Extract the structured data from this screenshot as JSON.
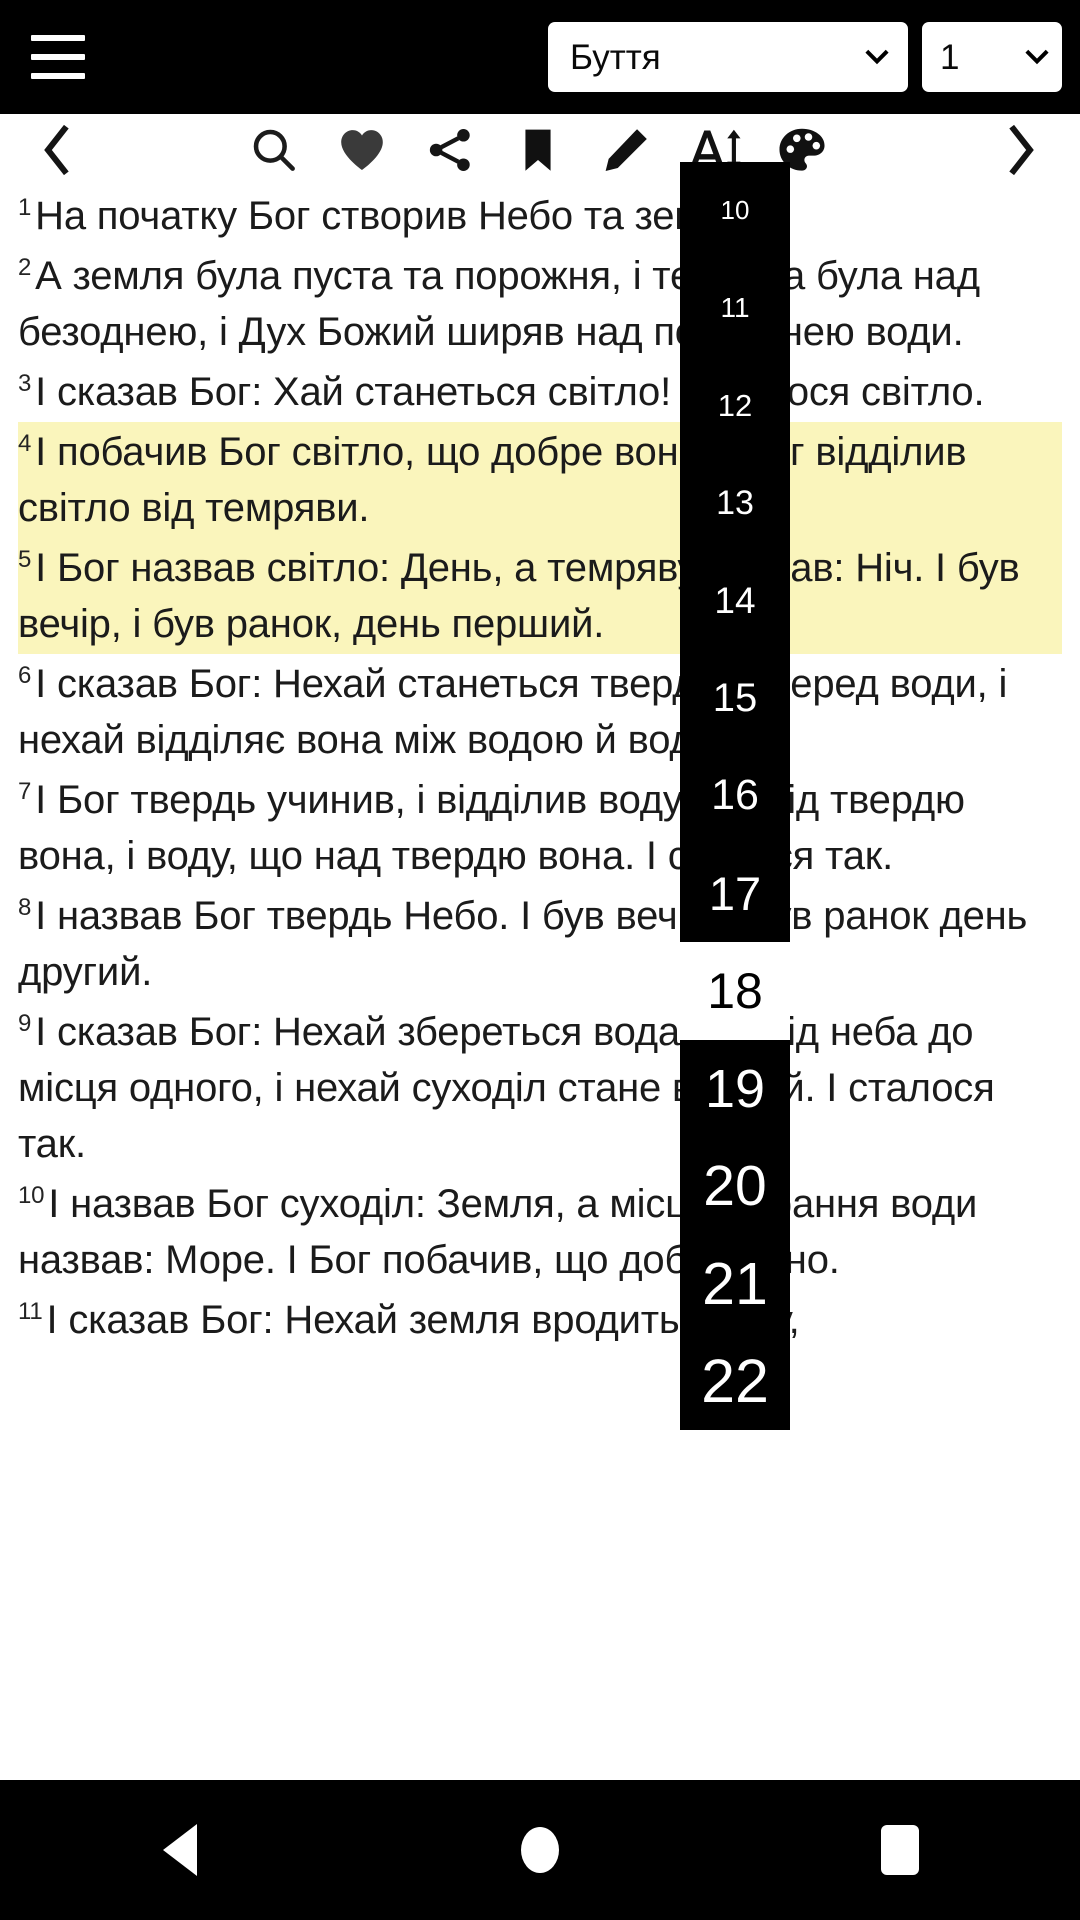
{
  "topbar": {
    "menu_icon": "hamburger-menu-icon",
    "book_selector": {
      "value": "Буття",
      "caret_icon": "chevron-down-icon"
    },
    "chapter_selector": {
      "value": "1",
      "caret_icon": "chevron-down-icon"
    },
    "background": "#000000"
  },
  "toolbar": {
    "prev_label": "previous-chapter",
    "next_label": "next-chapter",
    "items": [
      {
        "name": "search-icon",
        "label": "Search"
      },
      {
        "name": "heart-icon",
        "label": "Favorite"
      },
      {
        "name": "share-icon",
        "label": "Share"
      },
      {
        "name": "bookmark-icon",
        "label": "Bookmark"
      },
      {
        "name": "pencil-icon",
        "label": "Note"
      },
      {
        "name": "font-size-icon",
        "label": "Font size"
      },
      {
        "name": "palette-icon",
        "label": "Theme"
      }
    ]
  },
  "content": {
    "highlight_color": "#faf5bc",
    "verses": [
      {
        "num": "1",
        "text": "На початку Бог створив Небо та землю.",
        "highlight": false
      },
      {
        "num": "2",
        "text": "А земля була пуста та порожня, і темрява була над безоднею, і Дух Божий ширяв над поверхнею води.",
        "highlight": false
      },
      {
        "num": "3",
        "text": "І сказав Бог: Хай станеться світло! І сталося світло.",
        "highlight": false
      },
      {
        "num": "4",
        "text": "І побачив Бог світло, що добре воно, і Бог відділив світло від темряви.",
        "highlight": true
      },
      {
        "num": "5",
        "text": "І Бог назвав світло: День, а темряву назвав: Ніч. І був вечір, і був ранок, день перший.",
        "highlight": true
      },
      {
        "num": "6",
        "text": "І сказав Бог: Нехай станеться твердь посеред води, і нехай відділяє вона між водою й водою.",
        "highlight": false
      },
      {
        "num": "7",
        "text": "І Бог твердь учинив, і відділив воду, що під твердю вона, і воду, що над твердю вона. І сталося так.",
        "highlight": false
      },
      {
        "num": "8",
        "text": "І назвав Бог твердь Небо. І був вечір, і був ранок день другий.",
        "highlight": false
      },
      {
        "num": "9",
        "text": "І сказав Бог: Нехай збереться вода з-попід неба до місця одного, і нехай суходіл стане видний. І сталося так.",
        "highlight": false
      },
      {
        "num": "10",
        "text": "І назвав Бог суходіл: Земля, а місце зібрання води назвав: Море. І Бог побачив, що добре воно.",
        "highlight": false
      },
      {
        "num": "11",
        "text": "І сказав Бог: Нехай земля вродить траву,",
        "highlight": false
      }
    ]
  },
  "scroll_overlay": {
    "background": "#000000",
    "selected_value": "18",
    "items": [
      {
        "label": "10",
        "size": 26,
        "selected": false
      },
      {
        "label": "11",
        "size": 28,
        "selected": false
      },
      {
        "label": "12",
        "size": 31,
        "selected": false
      },
      {
        "label": "13",
        "size": 34,
        "selected": false
      },
      {
        "label": "14",
        "size": 37,
        "selected": false
      },
      {
        "label": "15",
        "size": 40,
        "selected": false
      },
      {
        "label": "16",
        "size": 43,
        "selected": false
      },
      {
        "label": "17",
        "size": 47,
        "selected": false
      },
      {
        "label": "18",
        "size": 50,
        "selected": true
      },
      {
        "label": "19",
        "size": 54,
        "selected": false
      },
      {
        "label": "20",
        "size": 57,
        "selected": false
      },
      {
        "label": "21",
        "size": 59,
        "selected": false
      },
      {
        "label": "22",
        "size": 61,
        "selected": false
      }
    ]
  },
  "navbar": {
    "background": "#000000",
    "back": "back-triangle-icon",
    "home": "home-circle-icon",
    "recents": "recents-square-icon"
  }
}
